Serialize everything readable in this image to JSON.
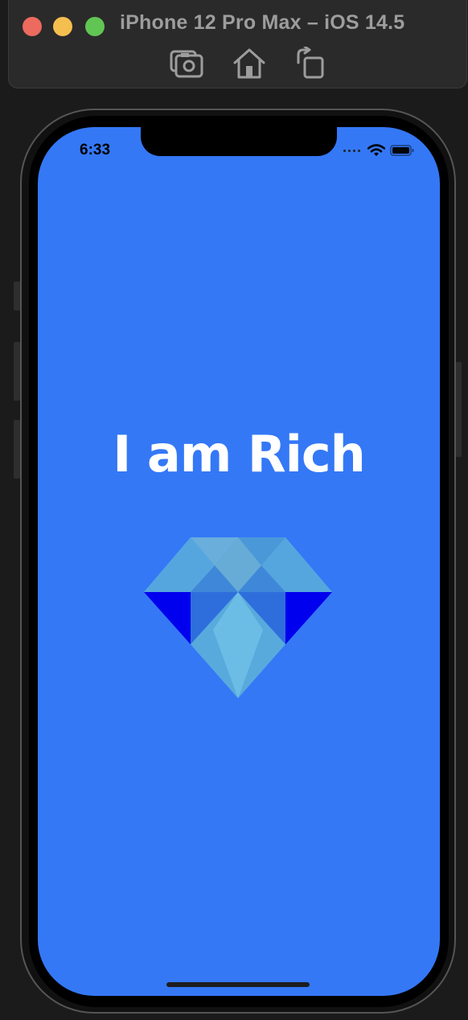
{
  "window": {
    "title": "iPhone 12 Pro Max – iOS 14.5",
    "toolbar_icons": [
      "screenshot-icon",
      "home-icon",
      "rotate-icon"
    ]
  },
  "status_bar": {
    "time": "6:33",
    "icons": [
      "signal-icon",
      "wifi-icon",
      "battery-icon"
    ]
  },
  "app": {
    "title": "I am Rich",
    "image": "diamond-image",
    "background_color": "#3478f6"
  }
}
